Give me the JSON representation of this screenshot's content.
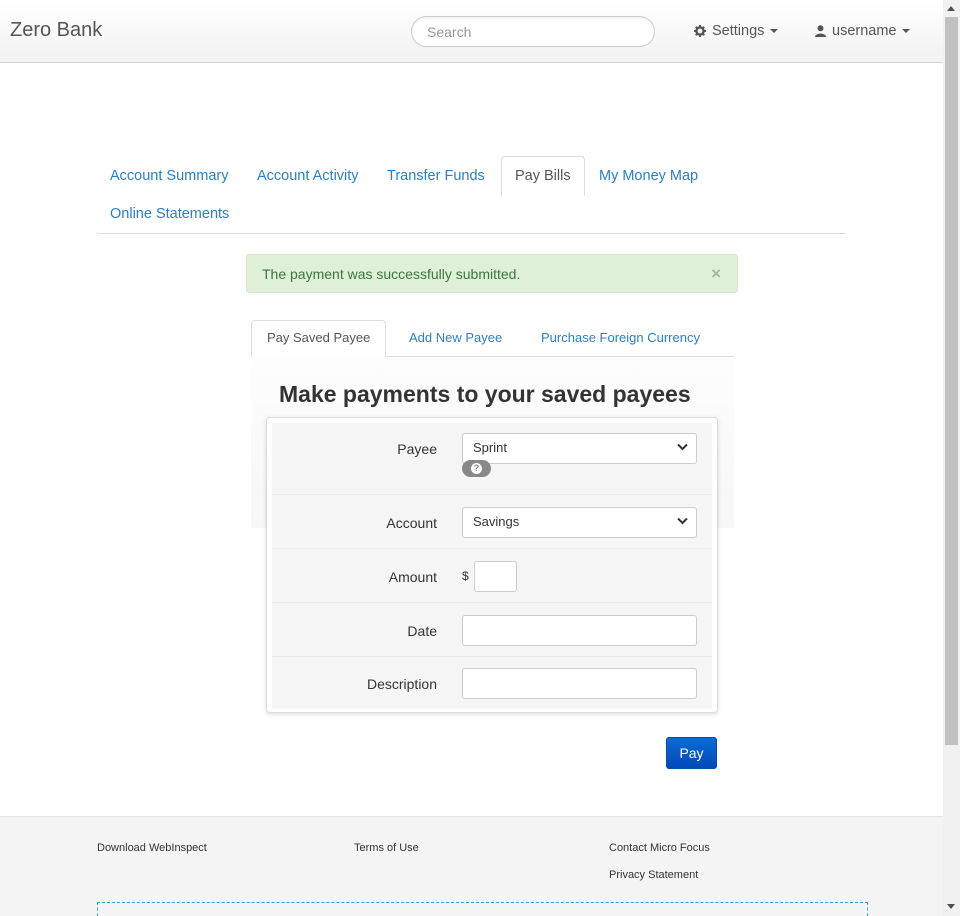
{
  "navbar": {
    "brand": "Zero Bank",
    "search_placeholder": "Search",
    "settings_label": "Settings",
    "user_label": "username"
  },
  "main_tabs": [
    {
      "label": "Account Summary",
      "active": false
    },
    {
      "label": "Account Activity",
      "active": false
    },
    {
      "label": "Transfer Funds",
      "active": false
    },
    {
      "label": "Pay Bills",
      "active": true
    },
    {
      "label": "My Money Map",
      "active": false
    },
    {
      "label": "Online Statements",
      "active": false
    }
  ],
  "alert": {
    "message": "The payment was successfully submitted.",
    "close": "×"
  },
  "sub_tabs": [
    {
      "label": "Pay Saved Payee",
      "active": true
    },
    {
      "label": "Add New Payee",
      "active": false
    },
    {
      "label": "Purchase Foreign Currency",
      "active": false
    }
  ],
  "form": {
    "title": "Make payments to your saved payees",
    "payee_label": "Payee",
    "payee_value": "Sprint",
    "help_icon": "?",
    "account_label": "Account",
    "account_value": "Savings",
    "amount_label": "Amount",
    "currency_symbol": "$",
    "amount_value": "",
    "date_label": "Date",
    "date_value": "",
    "description_label": "Description",
    "description_value": "",
    "pay_label": "Pay"
  },
  "footer": {
    "download": "Download WebInspect",
    "terms": "Terms of Use",
    "contact": "Contact Micro Focus",
    "privacy": "Privacy Statement"
  },
  "colors": {
    "link": "#2a7fc7",
    "primary_button": "#0a5ccc",
    "alert_bg": "#dff0d8",
    "alert_text": "#3c763d"
  }
}
